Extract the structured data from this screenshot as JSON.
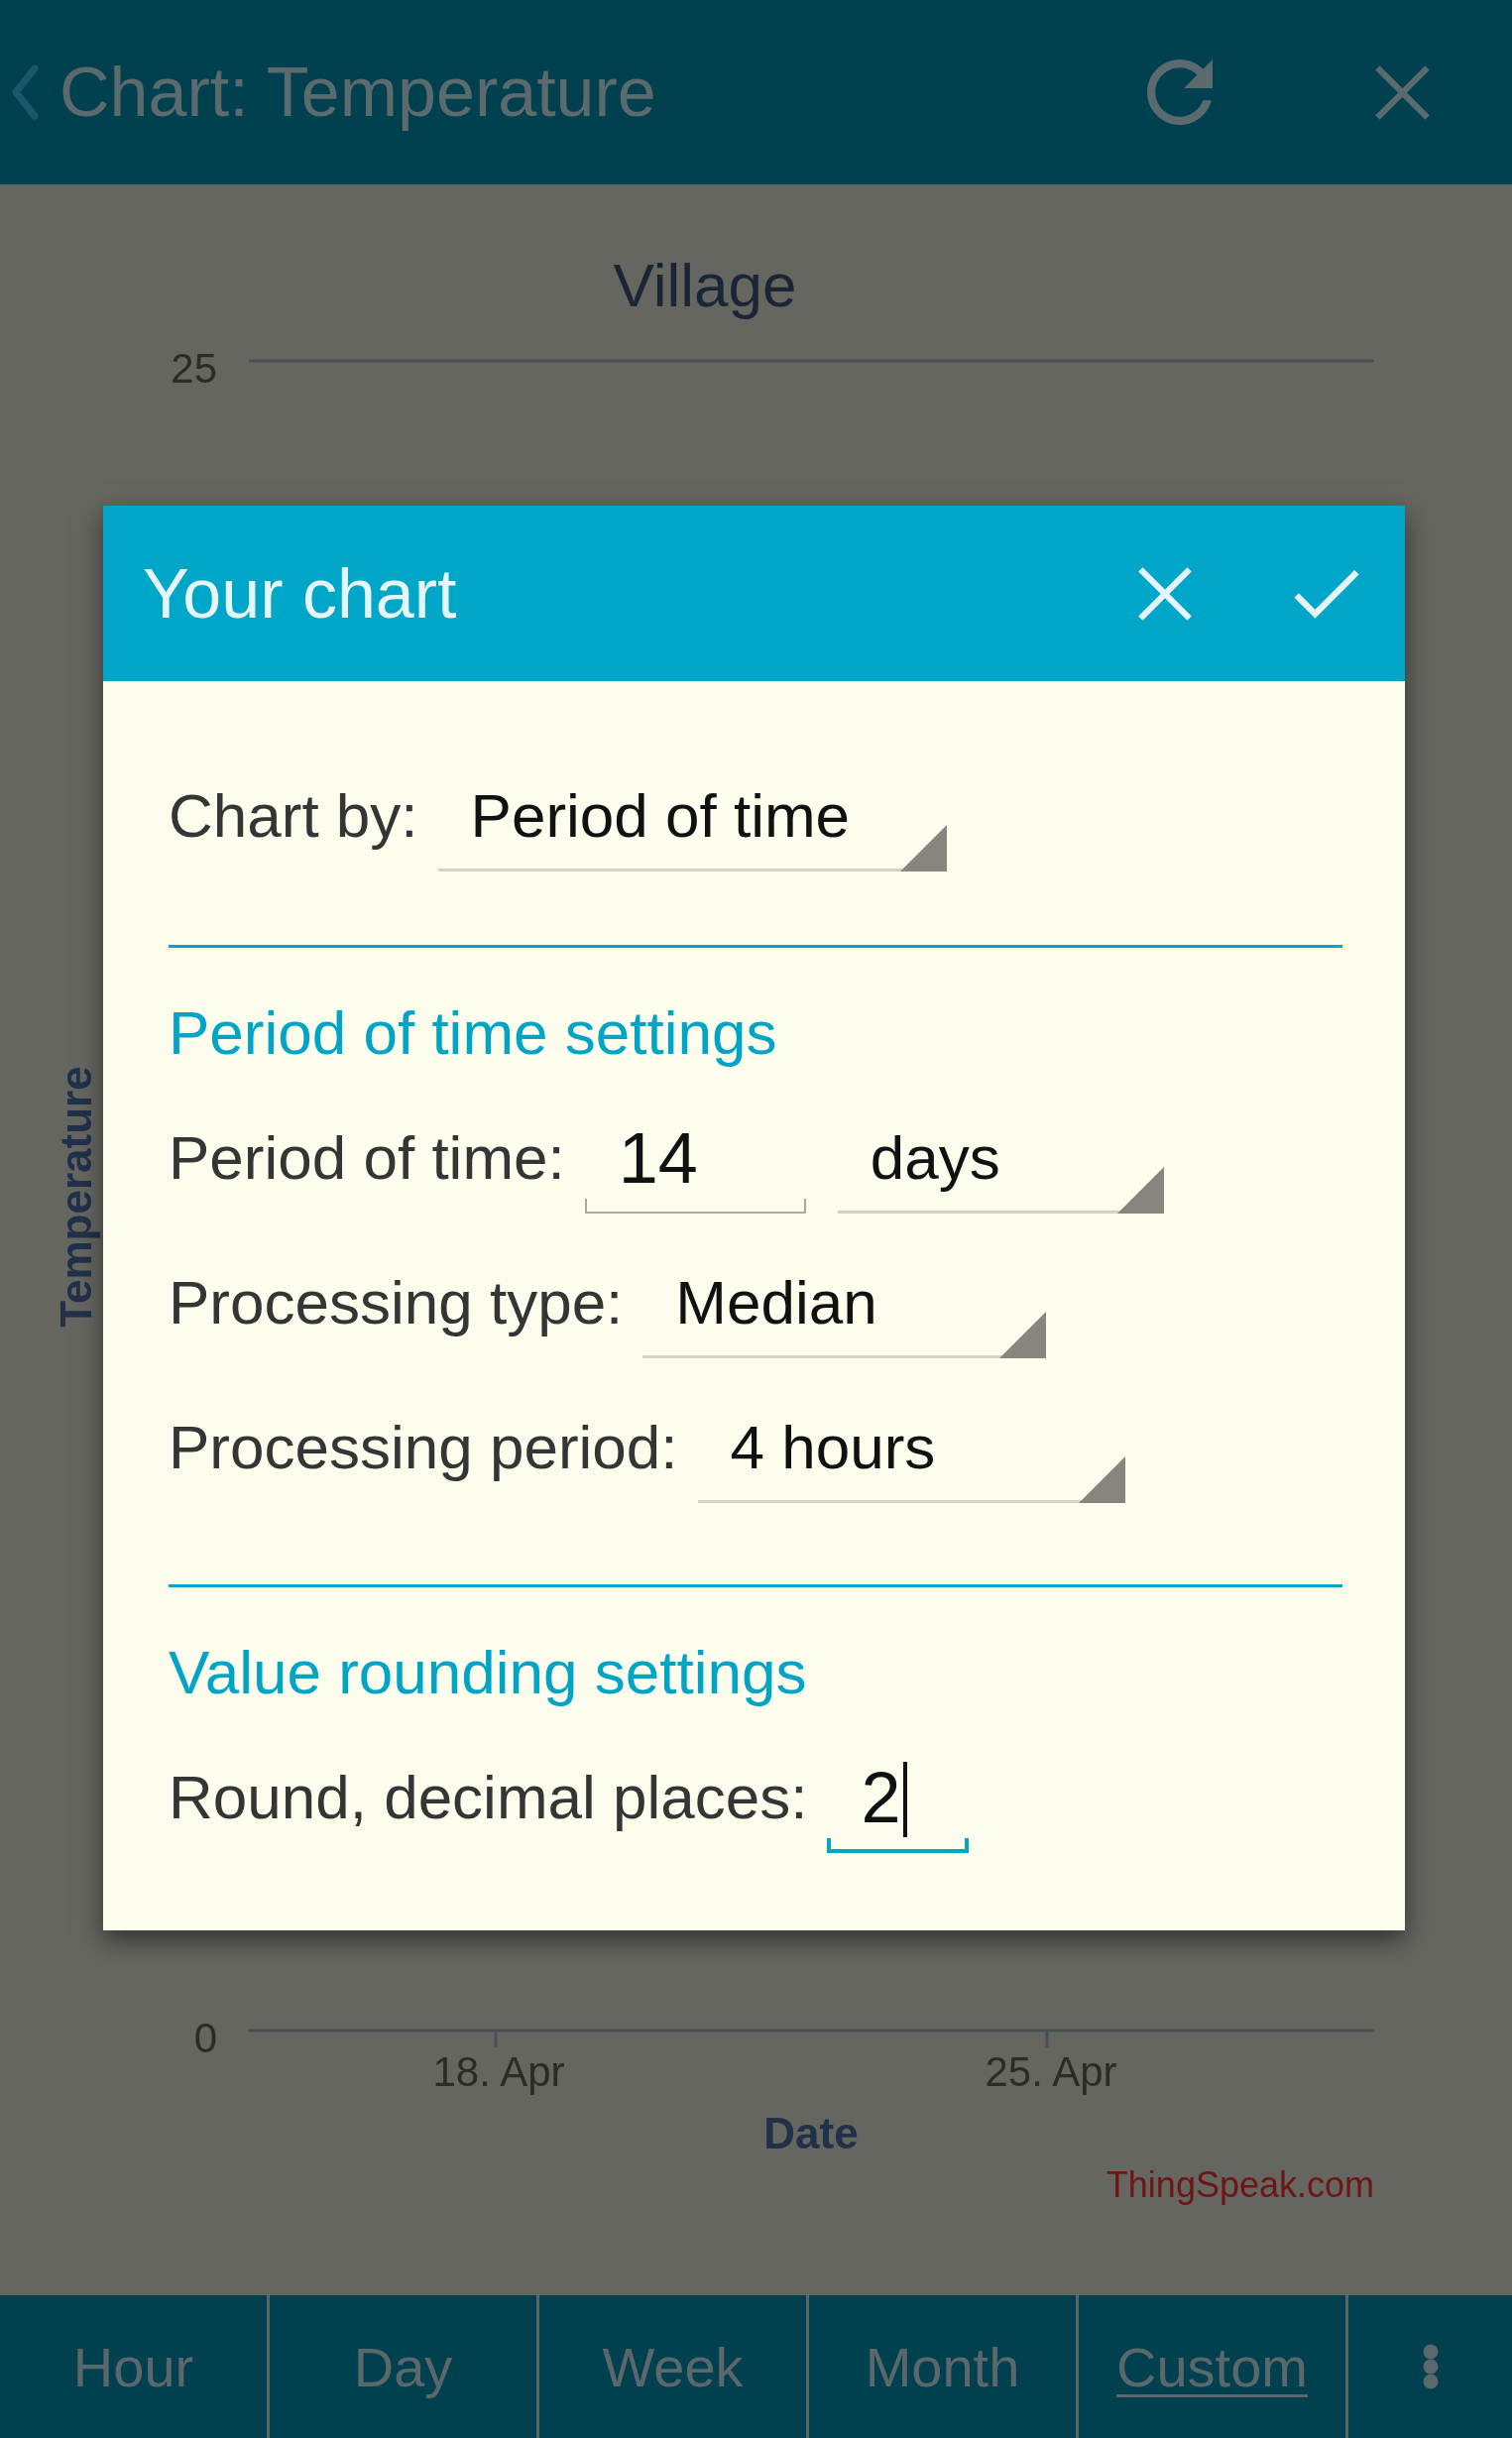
{
  "app_bar": {
    "title": "Chart: Temperature"
  },
  "chart": {
    "title": "Village",
    "y_axis_title": "Temperature",
    "y_tick_labels": [
      "25",
      "0"
    ],
    "x_tick_labels": [
      "18. Apr",
      "25. Apr"
    ],
    "x_axis_title": "Date",
    "credit": "ThingSpeak.com"
  },
  "dialog": {
    "title": "Your chart",
    "chart_by": {
      "label": "Chart by:",
      "value": "Period of time",
      "focused": false
    },
    "sections": [
      {
        "heading": "Period of time settings",
        "fields": [
          {
            "kind": "number_unit",
            "label": "Period of time:",
            "value": "14",
            "unit": "days",
            "focused": false
          },
          {
            "kind": "dropdown",
            "label": "Processing type:",
            "value": "Median",
            "focused": false
          },
          {
            "kind": "dropdown",
            "label": "Processing period:",
            "value": "4 hours",
            "focused": false
          }
        ]
      },
      {
        "heading": "Value rounding settings",
        "fields": [
          {
            "kind": "number",
            "label": "Round, decimal places:",
            "value": "2",
            "focused": true
          }
        ]
      }
    ]
  },
  "bottom_tabs": [
    {
      "label": "Hour",
      "selected": false
    },
    {
      "label": "Day",
      "selected": false
    },
    {
      "label": "Week",
      "selected": false
    },
    {
      "label": "Month",
      "selected": false
    },
    {
      "label": "Custom",
      "selected": true
    }
  ]
}
